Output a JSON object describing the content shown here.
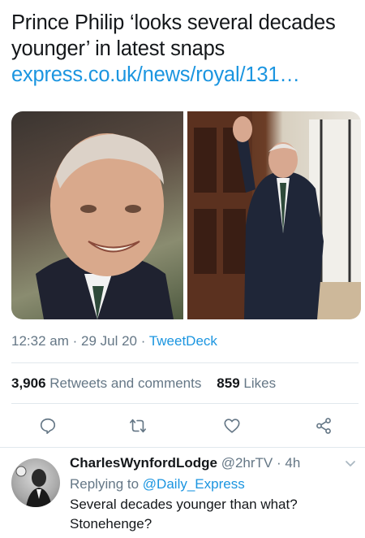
{
  "tweet": {
    "text": "Prince Philip ‘looks several decades younger’ in latest snaps",
    "link": "express.co.uk/news/royal/131…"
  },
  "meta": {
    "time": "12:32 am",
    "sep1": " · ",
    "date": "29 Jul 20",
    "sep2": " · ",
    "source": "TweetDeck"
  },
  "stats": {
    "retweets_count": "3,906",
    "retweets_label": "Retweets and comments",
    "likes_count": "859",
    "likes_label": "Likes"
  },
  "actions": {
    "icons": [
      "comment-icon",
      "retweet-icon",
      "like-icon",
      "share-icon"
    ]
  },
  "reply": {
    "name": "CharlesWynfordLodge",
    "handle": "@2hrTV",
    "sep": " · ",
    "time": "4h",
    "replying_prefix": "Replying to",
    "replying_to": "@Daily_Express",
    "text": "Several decades younger than what? Stonehenge?"
  },
  "colors": {
    "accent": "#1b95e0",
    "muted": "#657786",
    "text": "#14171a",
    "divider": "#e1e8ed"
  }
}
